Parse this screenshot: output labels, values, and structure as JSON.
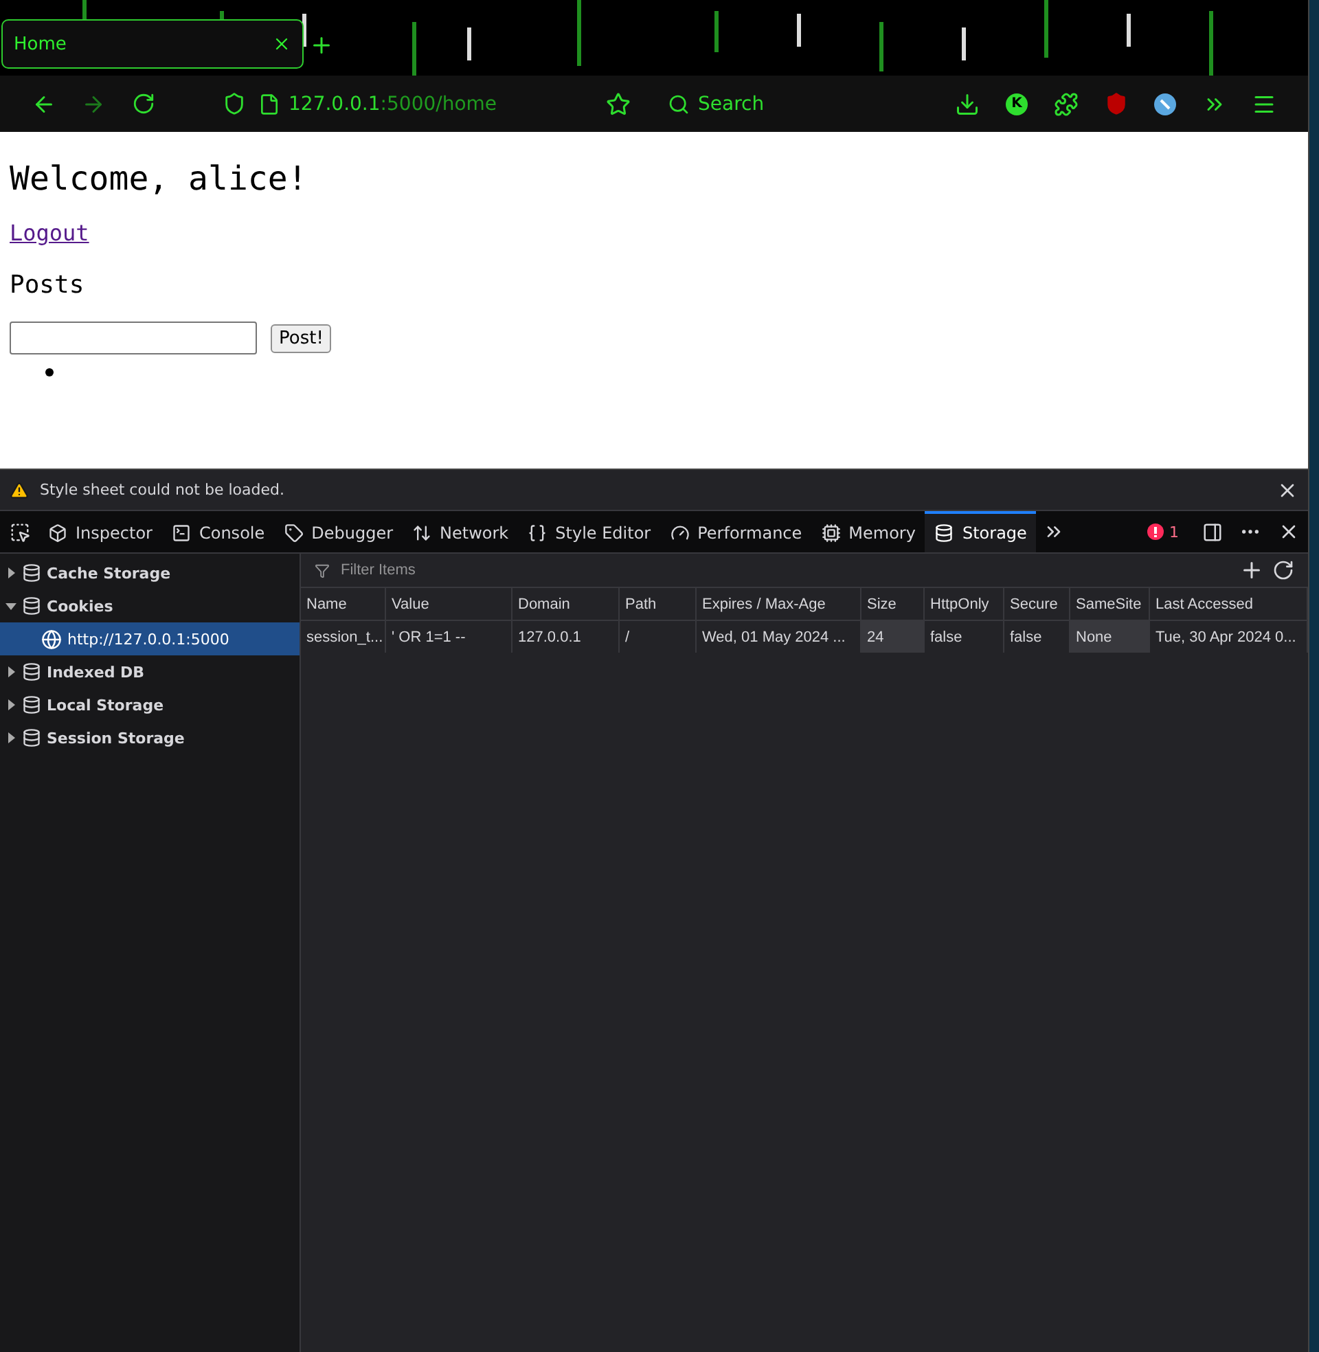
{
  "browser": {
    "tabs": [
      {
        "title": "Home",
        "selected": true
      }
    ],
    "url": {
      "host": "127.0.0.1",
      "rest": ":5000/home"
    },
    "search": {
      "placeholder": "Search"
    },
    "extension_badge": "K"
  },
  "page": {
    "heading": "Welcome, alice!",
    "link": "Logout",
    "subheading": "Posts",
    "post_button": "Post!",
    "posts": [
      {
        "kind": "empty"
      }
    ]
  },
  "devtools": {
    "notification": "Style sheet could not be loaded.",
    "tabs": [
      {
        "label": "Inspector",
        "selected": false
      },
      {
        "label": "Console",
        "selected": false
      },
      {
        "label": "Debugger",
        "selected": false
      },
      {
        "label": "Network",
        "selected": false
      },
      {
        "label": "Style Editor",
        "selected": false
      },
      {
        "label": "Performance",
        "selected": false
      },
      {
        "label": "Memory",
        "selected": false
      },
      {
        "label": "Storage",
        "selected": true
      }
    ],
    "error_count": "1",
    "tree": [
      {
        "label": "Cache Storage",
        "expanded": false,
        "selected": false
      },
      {
        "label": "Cookies",
        "expanded": true,
        "selected": false,
        "children": [
          {
            "label": "http://127.0.0.1:5000",
            "selected": true
          }
        ]
      },
      {
        "label": "Indexed DB",
        "expanded": false,
        "selected": false
      },
      {
        "label": "Local Storage",
        "expanded": false,
        "selected": false
      },
      {
        "label": "Session Storage",
        "expanded": false,
        "selected": false
      }
    ],
    "filter": {
      "placeholder": "Filter Items"
    },
    "table": {
      "columns": [
        "Name",
        "Value",
        "Domain",
        "Path",
        "Expires / Max-Age",
        "Size",
        "HttpOnly",
        "Secure",
        "SameSite",
        "Last Accessed"
      ],
      "rows": [
        [
          "session_t...",
          "' OR 1=1 --",
          "127.0.0.1",
          "/",
          "Wed, 01 May 2024 ...",
          "24",
          "false",
          "false",
          "None",
          "Tue, 30 Apr 2024 0..."
        ]
      ]
    }
  }
}
